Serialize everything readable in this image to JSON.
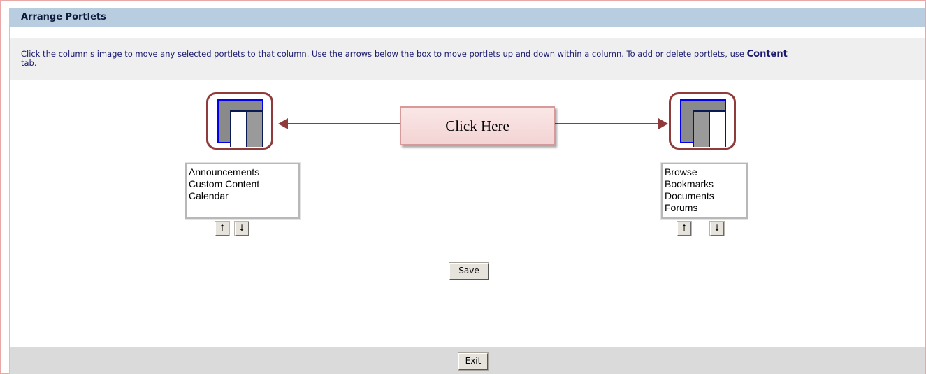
{
  "panel": {
    "title": "Arrange Portlets"
  },
  "instructions": {
    "text": "Click the column's image to move any selected portlets to that column. Use the arrows below the box to move portlets up and down within a column. To add or delete portlets, use ",
    "bold": "Content",
    "tail": "tab."
  },
  "callout": {
    "label": "Click Here"
  },
  "left_column": {
    "items": [
      "Announcements",
      "Custom Content",
      "Calendar"
    ],
    "up_icon": "arrow-up-icon",
    "down_icon": "arrow-down-icon"
  },
  "right_column": {
    "items": [
      "Browse",
      "Bookmarks",
      "Documents",
      "Forums"
    ],
    "up_icon": "arrow-up-icon",
    "down_icon": "arrow-down-icon"
  },
  "buttons": {
    "save": "Save",
    "exit": "Exit",
    "up": "↑",
    "down": "↓"
  },
  "colors": {
    "title_bar": "#b9cde0",
    "callout_border": "#8f3b3b",
    "column_border": "#0000ee"
  }
}
